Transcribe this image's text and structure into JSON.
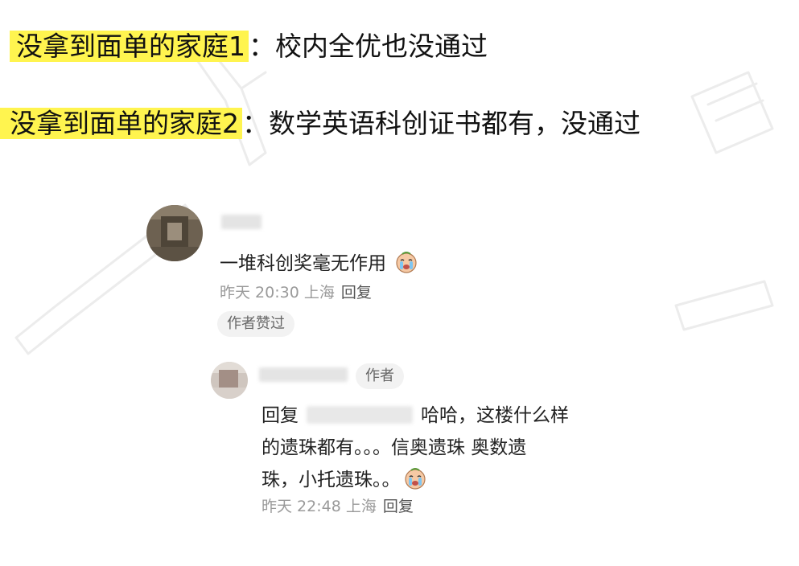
{
  "headlines": [
    {
      "highlight": "没拿到面单的家庭1",
      "rest": "：校内全优也没通过"
    },
    {
      "highlight": "没拿到面单的家庭2",
      "rest": "：数学英语科创证书都有，没通过"
    }
  ],
  "colors": {
    "highlight": "#fff44f",
    "meta": "#9a9a9a",
    "chip_bg": "#f2f2f2"
  },
  "comment": {
    "text": "一堆科创奖毫无作用",
    "emoji": "crying-face-emoji",
    "time": "昨天 20:30 上海",
    "reply_label": "回复",
    "badge": "作者赞过"
  },
  "reply": {
    "author_tag": "作者",
    "prefix": "回复",
    "line1_rest": "哈哈，这楼什么样",
    "line2": "的遗珠都有。。。信奥遗珠 奥数遗",
    "line3": "珠，小托遗珠。。",
    "emoji": "crying-face-emoji",
    "time": "昨天 22:48 上海",
    "reply_label": "回复"
  }
}
